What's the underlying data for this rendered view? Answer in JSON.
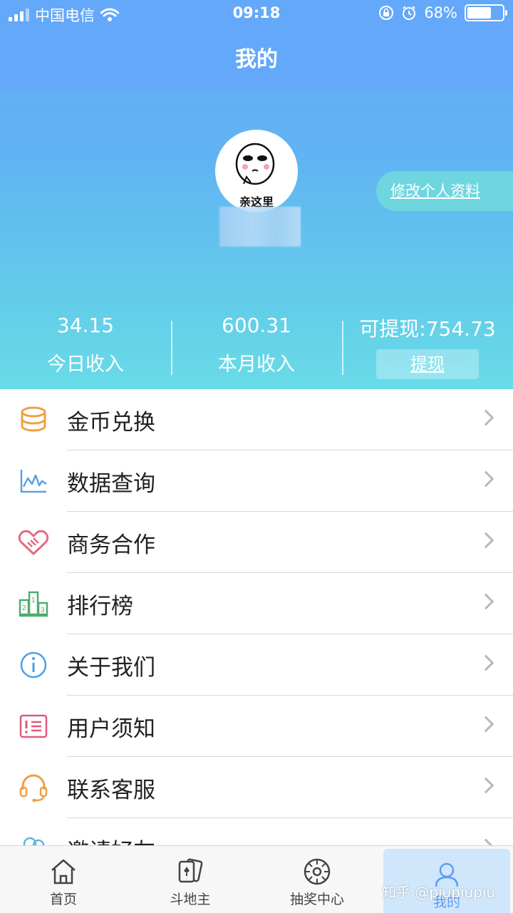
{
  "status_bar": {
    "carrier": "中国电信",
    "time": "09:18",
    "battery": "68%"
  },
  "page_title": "我的",
  "profile": {
    "avatar_caption": "亲这里",
    "edit_label": "修改个人资料"
  },
  "stats": [
    {
      "value": "34.15",
      "label": "今日收入"
    },
    {
      "value": "600.31",
      "label": "本月收入"
    },
    {
      "value": "可提现:754.73",
      "button": "提现"
    }
  ],
  "menu": [
    {
      "label": "金币兑换",
      "icon": "coins-icon",
      "color": "#f0a040"
    },
    {
      "label": "数据查询",
      "icon": "chart-line-icon",
      "color": "#5aa0e0"
    },
    {
      "label": "商务合作",
      "icon": "handshake-icon",
      "color": "#e26b82"
    },
    {
      "label": "排行榜",
      "icon": "podium-icon",
      "color": "#4cae6e"
    },
    {
      "label": "关于我们",
      "icon": "info-icon",
      "color": "#4a9fe6"
    },
    {
      "label": "用户须知",
      "icon": "notice-icon",
      "color": "#e05a7a"
    },
    {
      "label": "联系客服",
      "icon": "headset-icon",
      "color": "#f0a040"
    },
    {
      "label": "邀请好友",
      "icon": "invite-icon",
      "color": "#5ab8d8"
    }
  ],
  "tabbar": [
    {
      "label": "首页",
      "icon": "home-icon"
    },
    {
      "label": "斗地主",
      "icon": "cards-icon"
    },
    {
      "label": "抽奖中心",
      "icon": "lottery-wheel-icon"
    },
    {
      "label": "我的",
      "icon": "user-icon",
      "active": true
    }
  ],
  "watermark": "知乎 @piupiupiu"
}
